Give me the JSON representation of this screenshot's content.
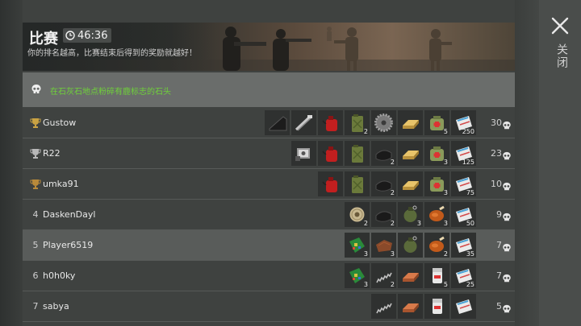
{
  "header": {
    "title": "比赛",
    "timer": "46:36",
    "subtitle": "你的排名越高，比赛结束后得到的奖励就越好！"
  },
  "task": {
    "text": "在石灰石地点粉碎有鹿标志的石头"
  },
  "close": {
    "label": "关闭"
  },
  "colors": {
    "accent_green": "#6fd13a",
    "gold": "#c9a243",
    "silver": "#b8b8b8",
    "bronze": "#b98a3a"
  },
  "players": [
    {
      "rank": "",
      "medal": "gold-trophy-icon",
      "name": "Gustow",
      "score": "30",
      "items": [
        {
          "icon": "black-panel-icon",
          "qty": ""
        },
        {
          "icon": "pipe-wrench-icon",
          "qty": ""
        },
        {
          "icon": "red-gas-can-icon",
          "qty": ""
        },
        {
          "icon": "jerrycan-icon",
          "qty": "2"
        },
        {
          "icon": "saw-blade-icon",
          "qty": ""
        },
        {
          "icon": "gold-bar-icon",
          "qty": ""
        },
        {
          "icon": "medkit-bag-icon",
          "qty": "5"
        },
        {
          "icon": "coupon-icon",
          "qty": "250"
        }
      ]
    },
    {
      "rank": "",
      "medal": "silver-trophy-icon",
      "name": "R22",
      "score": "23",
      "items": [
        {
          "icon": "engine-part-icon",
          "qty": ""
        },
        {
          "icon": "red-gas-can-icon",
          "qty": ""
        },
        {
          "icon": "jerrycan-icon",
          "qty": ""
        },
        {
          "icon": "black-fabric-icon",
          "qty": "2"
        },
        {
          "icon": "gold-bar-icon",
          "qty": ""
        },
        {
          "icon": "medkit-bag-icon",
          "qty": "3"
        },
        {
          "icon": "coupon-icon",
          "qty": "125"
        }
      ]
    },
    {
      "rank": "",
      "medal": "bronze-trophy-icon",
      "name": "umka91",
      "score": "10",
      "items": [
        {
          "icon": "red-gas-can-icon",
          "qty": ""
        },
        {
          "icon": "jerrycan-icon",
          "qty": ""
        },
        {
          "icon": "black-fabric-icon",
          "qty": "2"
        },
        {
          "icon": "gold-bar-icon",
          "qty": ""
        },
        {
          "icon": "medkit-bag-icon",
          "qty": "3"
        },
        {
          "icon": "coupon-icon",
          "qty": "75"
        }
      ]
    },
    {
      "rank": "4",
      "medal": "",
      "name": "DaskenDayl",
      "score": "9",
      "items": [
        {
          "icon": "wire-spool-icon",
          "qty": "2"
        },
        {
          "icon": "black-fabric-icon",
          "qty": "2"
        },
        {
          "icon": "grenade-icon",
          "qty": "3"
        },
        {
          "icon": "roast-chicken-icon",
          "qty": "3"
        },
        {
          "icon": "coupon-icon",
          "qty": "50"
        }
      ]
    },
    {
      "rank": "5",
      "medal": "",
      "name": "Player6519",
      "score": "7",
      "items": [
        {
          "icon": "circuit-board-icon",
          "qty": "3"
        },
        {
          "icon": "leather-icon",
          "qty": "3"
        },
        {
          "icon": "grenade-icon",
          "qty": ""
        },
        {
          "icon": "roast-chicken-icon",
          "qty": "2"
        },
        {
          "icon": "coupon-icon",
          "qty": "35"
        }
      ]
    },
    {
      "rank": "6",
      "medal": "",
      "name": "h0h0ky",
      "score": "7",
      "items": [
        {
          "icon": "circuit-board-icon",
          "qty": "3"
        },
        {
          "icon": "spring-icon",
          "qty": "2"
        },
        {
          "icon": "copper-bar-icon",
          "qty": ""
        },
        {
          "icon": "pill-bottle-icon",
          "qty": "5"
        },
        {
          "icon": "coupon-icon",
          "qty": "25"
        }
      ]
    },
    {
      "rank": "7",
      "medal": "",
      "name": "sabya",
      "score": "5",
      "items": [
        {
          "icon": "spring-icon",
          "qty": ""
        },
        {
          "icon": "copper-bar-icon",
          "qty": ""
        },
        {
          "icon": "pill-bottle-icon",
          "qty": ""
        },
        {
          "icon": "coupon-icon",
          "qty": ""
        }
      ]
    }
  ]
}
